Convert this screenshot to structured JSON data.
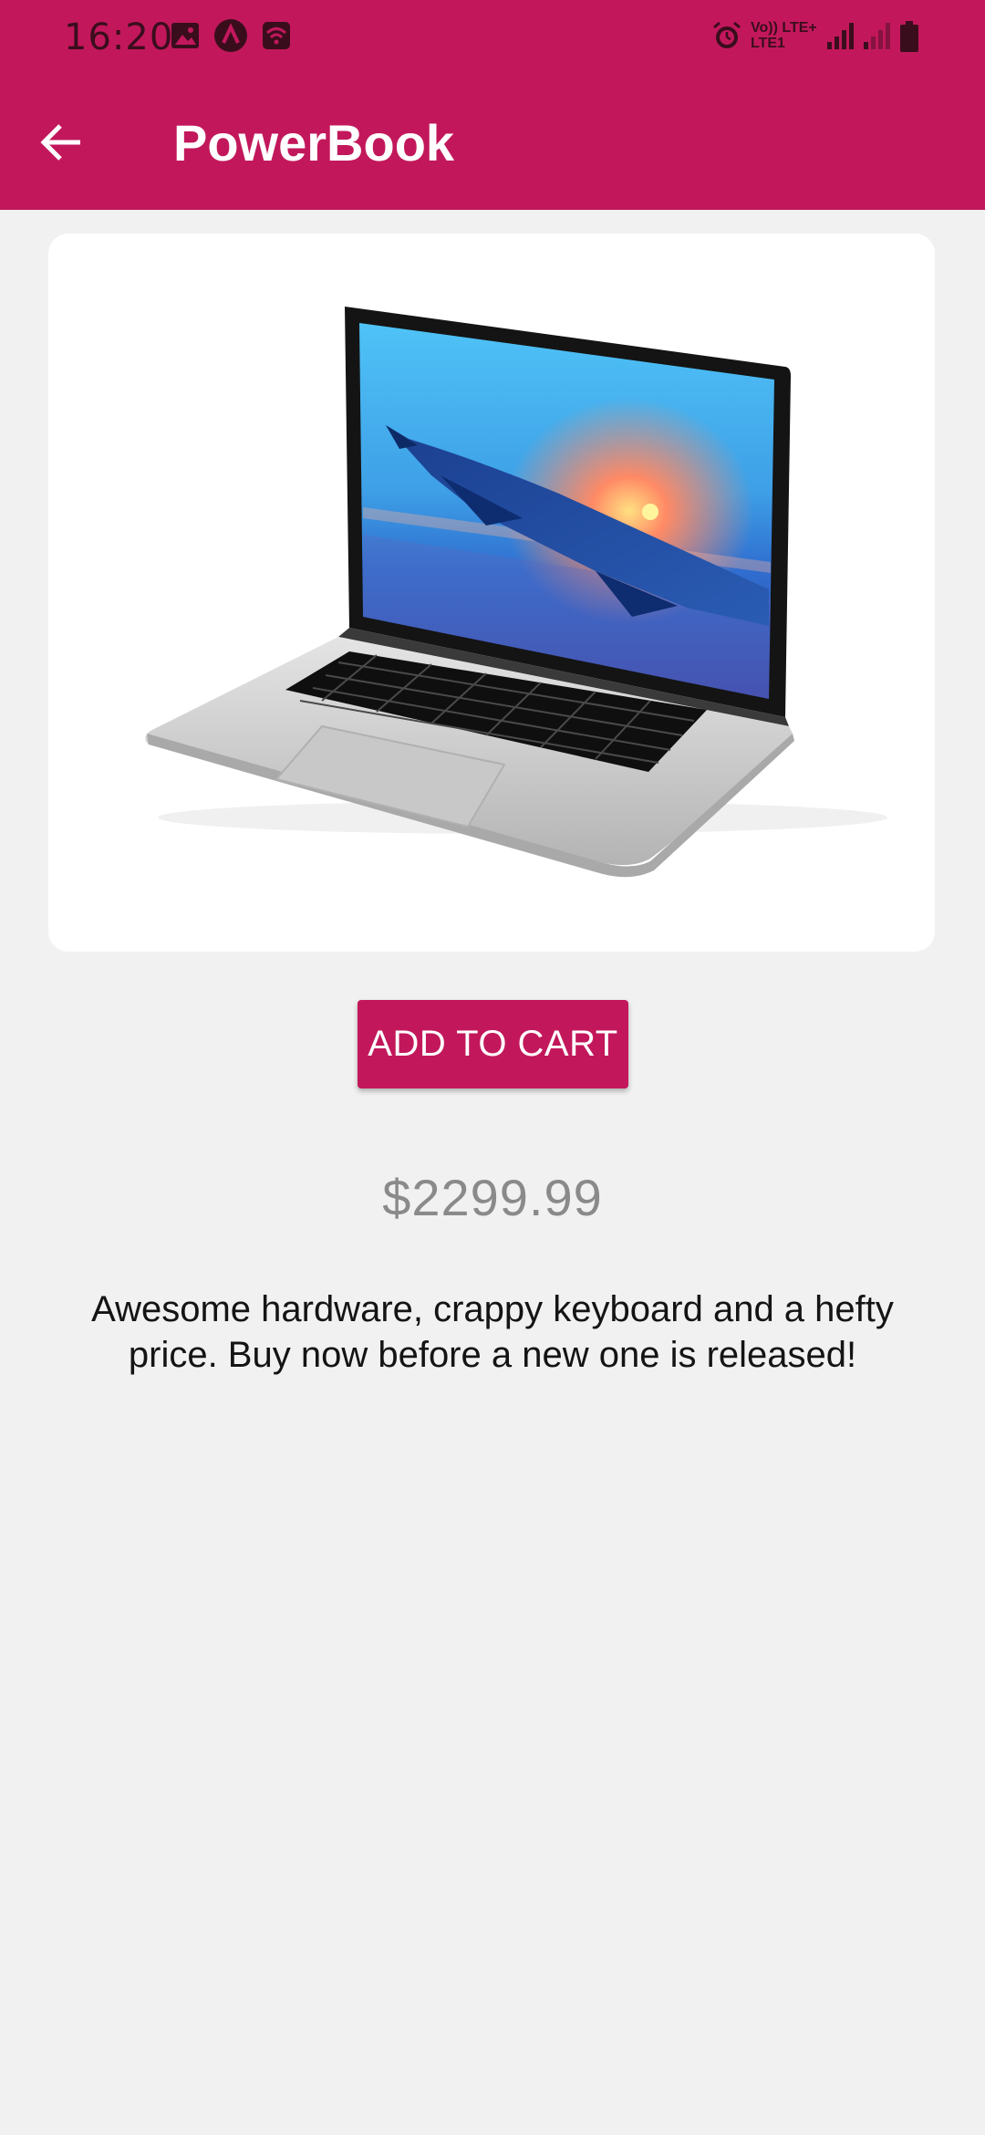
{
  "status_bar": {
    "time": "16:20",
    "icons": [
      "gallery-icon",
      "app-logo-icon",
      "wifi-calling-icon",
      "alarm-icon",
      "volte-icon",
      "signal-icon",
      "signal-weak-icon",
      "battery-icon"
    ],
    "network_label": "Vo)) LTE+",
    "network_label_2": "LTE1"
  },
  "toolbar": {
    "title": "PowerBook",
    "back_icon": "arrow-back-icon",
    "background_color": "#c2185b"
  },
  "product": {
    "image_description": "laptop-image",
    "add_to_cart_label": "ADD TO CART",
    "price": "$2299.99",
    "description": "Awesome hardware, crappy keyboard and a hefty price. Buy now before a new one is released!"
  }
}
